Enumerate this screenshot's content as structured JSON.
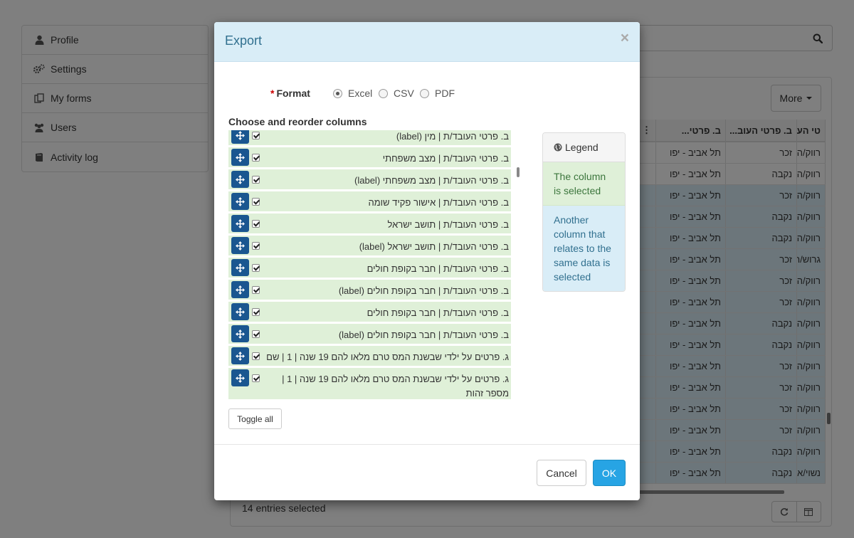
{
  "sidebar": {
    "items": [
      {
        "label": "Profile",
        "icon": "user-icon"
      },
      {
        "label": "Settings",
        "icon": "gears-icon"
      },
      {
        "label": "My forms",
        "icon": "forms-icon"
      },
      {
        "label": "Users",
        "icon": "users-icon"
      },
      {
        "label": "Activity log",
        "icon": "book-icon"
      }
    ]
  },
  "toolbar": {
    "more_label": "More"
  },
  "grid": {
    "headers": [
      "...ב. פרטי",
      "...ב. פרטי העוב",
      "טי העוב"
    ],
    "rows": [
      {
        "city": "תל אביב - יפו",
        "gender": "זכר",
        "role": "רווק/ה",
        "selected": false
      },
      {
        "city": "תל אביב - יפו",
        "gender": "נקבה",
        "role": "רווק/ה",
        "selected": false
      },
      {
        "city": "תל אביב - יפו",
        "gender": "זכר",
        "role": "רווק/ה",
        "selected": true
      },
      {
        "city": "תל אביב - יפו",
        "gender": "נקבה",
        "role": "רווק/ה",
        "selected": true
      },
      {
        "city": "תל אביב - יפו",
        "gender": "נקבה",
        "role": "רווק/ה",
        "selected": true
      },
      {
        "city": "תל אביב - יפו",
        "gender": "זכר",
        "role": "גרוש/ה",
        "selected": true
      },
      {
        "city": "תל אביב - יפו",
        "gender": "זכר",
        "role": "רווק/ה",
        "selected": true
      },
      {
        "city": "תל אביב - יפו",
        "gender": "זכר",
        "role": "רווק/ה",
        "selected": true
      },
      {
        "city": "תל אביב - יפו",
        "gender": "נקבה",
        "role": "רווק/ה",
        "selected": true
      },
      {
        "city": "תל אביב - יפו",
        "gender": "נקבה",
        "role": "רווק/ה",
        "selected": true
      },
      {
        "city": "תל אביב - יפו",
        "gender": "זכר",
        "role": "רווק/ה",
        "selected": true
      },
      {
        "city": "תל אביב - יפו",
        "gender": "זכר",
        "role": "רווק/ה",
        "selected": true
      },
      {
        "city": "תל אביב - יפו",
        "gender": "זכר",
        "role": "רווק/ה",
        "selected": true
      },
      {
        "city": "תל אביב - יפו",
        "gender": "זכר",
        "role": "רווק/ה",
        "selected": true
      },
      {
        "city": "תל אביב - יפו",
        "gender": "נקבה",
        "role": "רווק/ה",
        "selected": true
      },
      {
        "city": "תל אביב - יפו",
        "gender": "נקבה",
        "role": "נשוי/אה",
        "selected": true
      }
    ]
  },
  "footer": {
    "selected_text": "14 entries selected"
  },
  "modal": {
    "title": "Export",
    "close_symbol": "×",
    "format_label": "Format",
    "required_mark": "*",
    "format_options": [
      {
        "label": "Excel",
        "checked": true
      },
      {
        "label": "CSV",
        "checked": false
      },
      {
        "label": "PDF",
        "checked": false
      }
    ],
    "columns_label": "Choose and reorder columns",
    "columns": [
      "ב. פרטי העובד/ת | מין (label)",
      "ב. פרטי העובד/ת | מצב משפחתי",
      "ב. פרטי העובד/ת | מצב משפחתי (label)",
      "ב. פרטי העובד/ת | אישור פקיד שומה",
      "ב. פרטי העובד/ת | תושב ישראל",
      "ב. פרטי העובד/ת | תושב ישראל (label)",
      "ב. פרטי העובד/ת | חבר בקופת חולים",
      "ב. פרטי העובד/ת | חבר בקופת חולים (label)",
      "ב. פרטי העובד/ת | חבר בקופת חולים",
      "ב. פרטי העובד/ת | חבר בקופת חולים (label)",
      "ג. פרטים על ילדי שבשנת המס טרם מלאו להם 19 שנה | 1 | שם",
      "ג. פרטים על ילדי שבשנת המס טרם מלאו להם 19 שנה | 1 | מספר זהות"
    ],
    "legend": {
      "title": "Legend",
      "selected_text": "The column is selected",
      "related_text": "Another column that relates to the same data is selected"
    },
    "toggle_all_label": "Toggle all",
    "cancel_label": "Cancel",
    "ok_label": "OK"
  },
  "colors": {
    "header_bg": "#d9edf7",
    "title_color": "#31708f",
    "selected_bg": "#dff0d8",
    "related_bg": "#d9edf7",
    "drag_handle": "#1a5690",
    "ok_button": "#27a4e4"
  }
}
